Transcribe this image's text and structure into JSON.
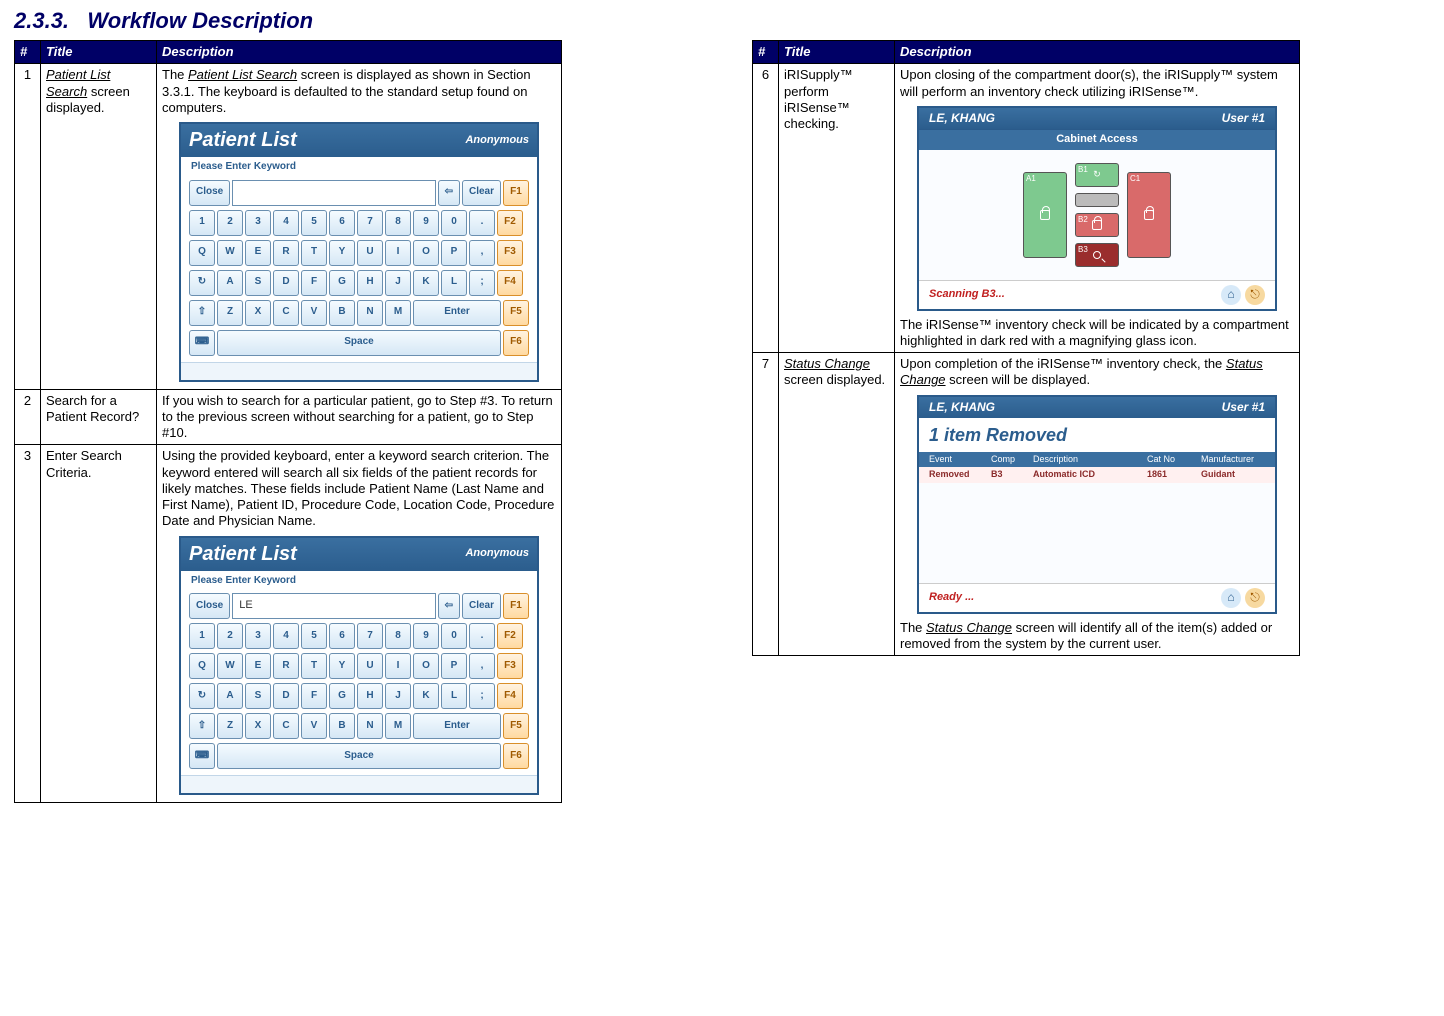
{
  "heading": {
    "num": "2.3.3.",
    "text": "Workflow Description"
  },
  "cols": {
    "h1": "#",
    "h2": "Title",
    "h3": "Description"
  },
  "left": [
    {
      "n": "1",
      "title_html": "<span class='italic u'>Patient List Search</span> screen displayed.",
      "desc_pre": "The <span class='italic u'>Patient List Search</span> screen is displayed as shown in Section 3.3.1.  The keyboard is defaulted to the standard setup found on computers.",
      "shot": "kb",
      "kb_value": "",
      "desc_post": ""
    },
    {
      "n": "2",
      "title_html": "Search for a Patient Record?",
      "desc_pre": "If you wish to search for a particular patient, go to Step #3.  To return to the previous screen without searching for a patient, go to Step #10.",
      "shot": null
    },
    {
      "n": "3",
      "title_html": "Enter Search Criteria.",
      "desc_pre": "Using the provided keyboard, enter a keyword search criterion.  The keyword entered will search all six fields of the patient records for likely matches.  These fields include Patient Name (Last Name and First Name), Patient ID, Procedure Code, Location Code, Procedure Date and Physician Name.",
      "shot": "kb",
      "kb_value": "LE",
      "desc_post": ""
    }
  ],
  "right": [
    {
      "n": "6",
      "title_html": "iRISupply™ perform iRISense™ checking.",
      "desc_pre": "Upon closing of the compartment door(s), the iRISupply™ system will perform an inventory check utilizing iRISense™.",
      "shot": "cab",
      "desc_post": "The iRISense™ inventory check will be indicated by a compartment highlighted in dark red with a magnifying glass icon."
    },
    {
      "n": "7",
      "title_html": "<span class='italic u'>Status Change</span> screen displayed.",
      "desc_pre": "Upon completion of the iRISense™ inventory check, the <span class='italic u'>Status Change</span> screen will be displayed.",
      "shot": "sc",
      "desc_post": "The <span class='italic u'>Status Change</span> screen will identify all of the item(s) added or removed from the system by the current user."
    }
  ],
  "kb": {
    "app_title": "Patient List",
    "app_user": "Anonymous",
    "subhead": "Please Enter Keyword",
    "close": "Close",
    "clear": "Clear",
    "enter": "Enter",
    "space": "Space",
    "back_arrow": "⇦",
    "row1": [
      "1",
      "2",
      "3",
      "4",
      "5",
      "6",
      "7",
      "8",
      "9",
      "0",
      "."
    ],
    "row2": [
      "Q",
      "W",
      "E",
      "R",
      "T",
      "Y",
      "U",
      "I",
      "O",
      "P",
      ","
    ],
    "row3": [
      "↻",
      "A",
      "S",
      "D",
      "F",
      "G",
      "H",
      "J",
      "K",
      "L",
      ";"
    ],
    "row4": [
      "⇧",
      "Z",
      "X",
      "C",
      "V",
      "B",
      "N",
      "M"
    ],
    "fkeys": [
      "F1",
      "F2",
      "F3",
      "F4",
      "F5",
      "F6"
    ]
  },
  "cab": {
    "user_name": "LE, KHANG",
    "user_badge": "User #1",
    "section_title": "Cabinet Access",
    "status": "Scanning B3...",
    "a1": "A1",
    "b1": "B1",
    "c1": "C1",
    "b2": "B2",
    "b3": "B3"
  },
  "sc": {
    "user_name": "LE, KHANG",
    "user_badge": "User #1",
    "title": "1 item Removed",
    "head": [
      "Event",
      "Comp",
      "Description",
      "Cat No",
      "Manufacturer"
    ],
    "row": [
      "Removed",
      "B3",
      "Automatic ICD",
      "1861",
      "Guidant"
    ],
    "status": "Ready ..."
  }
}
